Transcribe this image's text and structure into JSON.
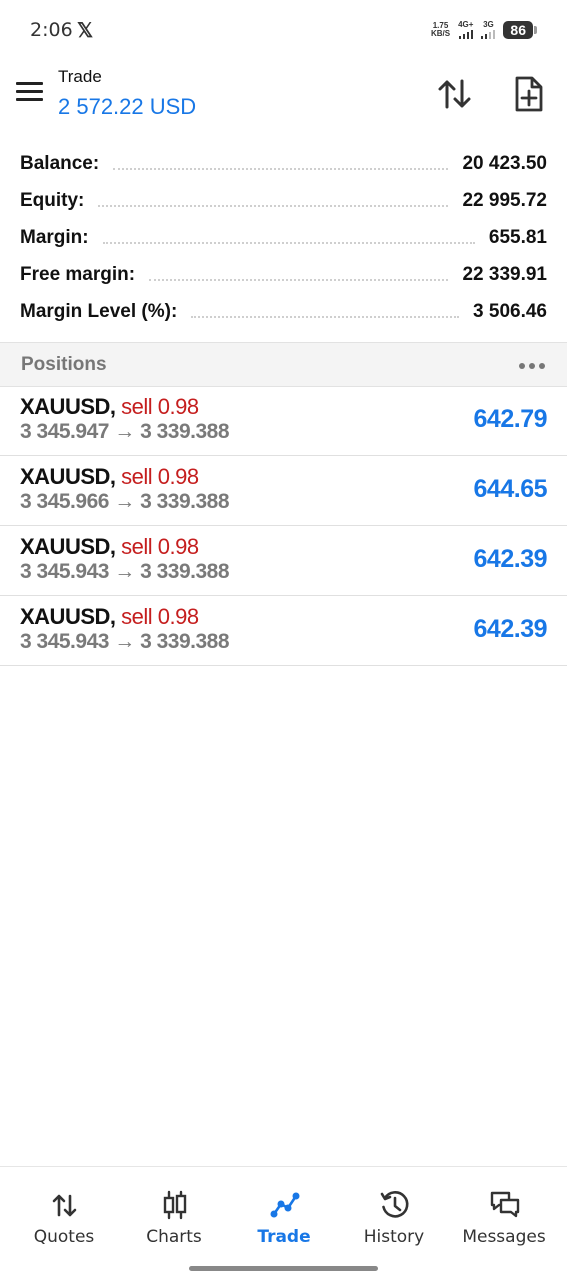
{
  "status_bar": {
    "time": "2:06",
    "x_logo": "𝕏",
    "net_speed_value": "1.75",
    "net_speed_unit": "KB/S",
    "signal1_label": "4G+",
    "signal2_label": "3G",
    "battery": "86"
  },
  "header": {
    "title": "Trade",
    "subtitle": "2 572.22 USD",
    "accent_color": "#1877e6"
  },
  "account": [
    {
      "label": "Balance:",
      "value": "20 423.50"
    },
    {
      "label": "Equity:",
      "value": "22 995.72"
    },
    {
      "label": "Margin:",
      "value": "655.81"
    },
    {
      "label": "Free margin:",
      "value": "22 339.91"
    },
    {
      "label": "Margin Level (%):",
      "value": "3 506.46"
    }
  ],
  "positions_section": {
    "title": "Positions"
  },
  "positions": [
    {
      "symbol": "XAUUSD,",
      "type": "sell 0.98",
      "prices": "3 345.947 → 3 339.388",
      "profit": "642.79"
    },
    {
      "symbol": "XAUUSD,",
      "type": "sell 0.98",
      "prices": "3 345.966 → 3 339.388",
      "profit": "644.65"
    },
    {
      "symbol": "XAUUSD,",
      "type": "sell 0.98",
      "prices": "3 345.943 → 3 339.388",
      "profit": "642.39"
    },
    {
      "symbol": "XAUUSD,",
      "type": "sell 0.98",
      "prices": "3 345.943 → 3 339.388",
      "profit": "642.39"
    }
  ],
  "bottom_nav": [
    {
      "label": "Quotes",
      "icon": "quotes-icon",
      "active": false
    },
    {
      "label": "Charts",
      "icon": "charts-icon",
      "active": false
    },
    {
      "label": "Trade",
      "icon": "trade-icon",
      "active": true
    },
    {
      "label": "History",
      "icon": "history-icon",
      "active": false
    },
    {
      "label": "Messages",
      "icon": "messages-icon",
      "active": false
    }
  ]
}
